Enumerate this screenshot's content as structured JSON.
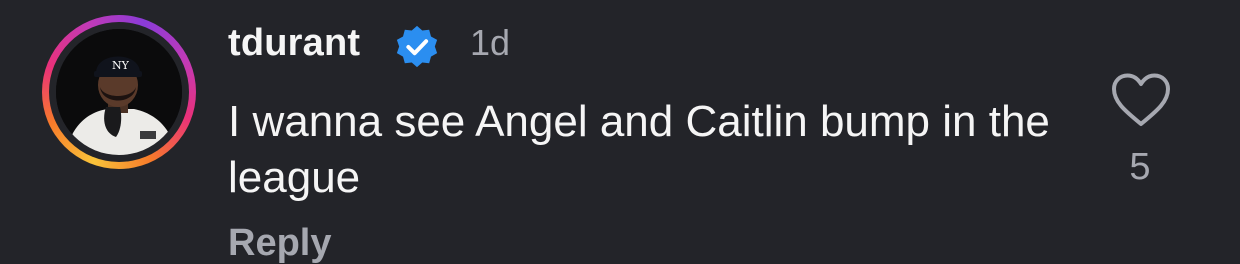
{
  "comment": {
    "username": "tdurant",
    "verified": true,
    "timestamp": "1d",
    "text": "I wanna see Angel and Caitlin bump in the league",
    "reply_label": "Reply",
    "like_count": "5",
    "avatar_icon": "user-avatar",
    "like_icon": "heart-outline-icon",
    "verified_icon": "verified-badge-icon"
  },
  "colors": {
    "background": "#232429",
    "primary_text": "#f5f5f5",
    "secondary_text": "#a6a8b0",
    "verified_blue": "#2b8ef0"
  }
}
